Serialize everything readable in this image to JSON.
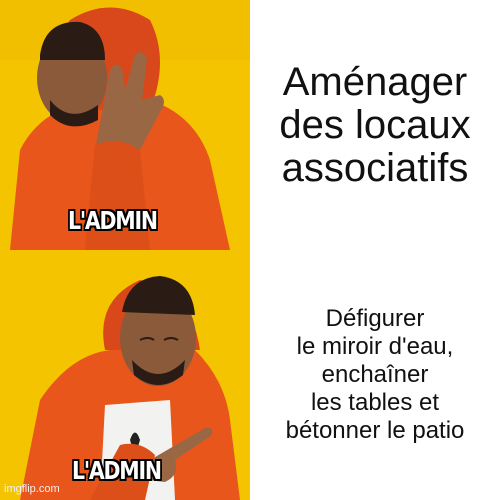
{
  "meme": {
    "top_caption": "Aménager\ndes locaux\nassociatifs",
    "bottom_caption": "Défigurer\nle miroir d'eau,\nenchaîner\nles tables et\nbétonner le patio",
    "top_label": "L'ADMIN",
    "bottom_label": "L'ADMIN",
    "watermark": "imgflip.com"
  },
  "colors": {
    "background_yellow": "#f5c400",
    "jacket_orange": "#e8561c",
    "caption_background": "#ffffff"
  }
}
